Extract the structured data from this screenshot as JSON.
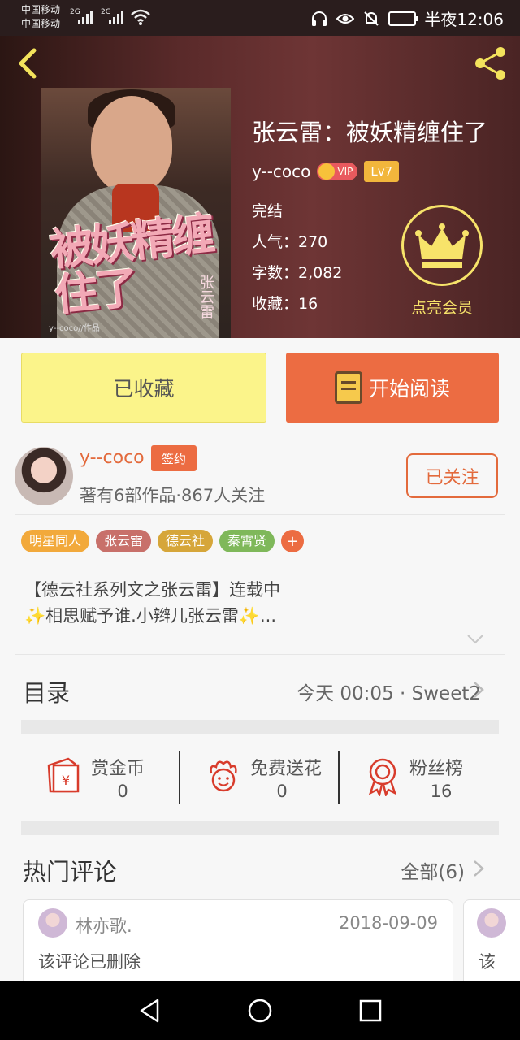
{
  "status_bar": {
    "carrier1": "中国移动",
    "carrier2": "中国移动",
    "net1": "2G",
    "net2": "2G",
    "time": "半夜12:06"
  },
  "book": {
    "title": "张云雷：被妖精缠住了",
    "author": "y--coco",
    "vip_label": "VIP",
    "level": "Lv7",
    "status": "完结",
    "popularity": "人气：270",
    "word_count": "字数：2,082",
    "favorites": "收藏：16",
    "member_label": "点亮会员",
    "cover_art_title": "被妖精缠住了",
    "cover_art_sub": "张云雷",
    "cover_credit": "y--coco//作品"
  },
  "actions": {
    "collected_label": "已收藏",
    "read_label": "开始阅读"
  },
  "author_info": {
    "name": "y--coco",
    "sign_badge": "签约",
    "stats": "著有6部作品·867人关注",
    "follow_label": "已关注"
  },
  "tags": [
    {
      "label": "明星同人",
      "color": "#f2a93b"
    },
    {
      "label": "张云雷",
      "color": "#c8706a"
    },
    {
      "label": "德云社",
      "color": "#d6a63a"
    },
    {
      "label": "秦霄贤",
      "color": "#7fb85a"
    }
  ],
  "tag_more": "+",
  "description": {
    "line1": "【德云社系列文之张云雷】连载中",
    "line2_text": "相思赋予谁.小辫儿张云雷",
    "line2_end": "..."
  },
  "catalog": {
    "title": "目录",
    "latest": "今天 00:05 · Sweet2"
  },
  "stats": [
    {
      "label": "赏金币",
      "value": "0",
      "icon": "red-envelope-icon"
    },
    {
      "label": "免费送花",
      "value": "0",
      "icon": "flower-icon"
    },
    {
      "label": "粉丝榜",
      "value": "16",
      "icon": "medal-icon"
    }
  ],
  "hot_comments": {
    "title": "热门评论",
    "all_label": "全部(6)",
    "items": [
      {
        "user": "林亦歌.",
        "date": "2018-09-09",
        "text": "该评论已删除"
      },
      {
        "user": "",
        "date": "",
        "text": "该"
      }
    ]
  },
  "colors": {
    "accent": "#ec6c42",
    "collect_bg": "#fbf48a",
    "crown": "#f7e36a"
  }
}
